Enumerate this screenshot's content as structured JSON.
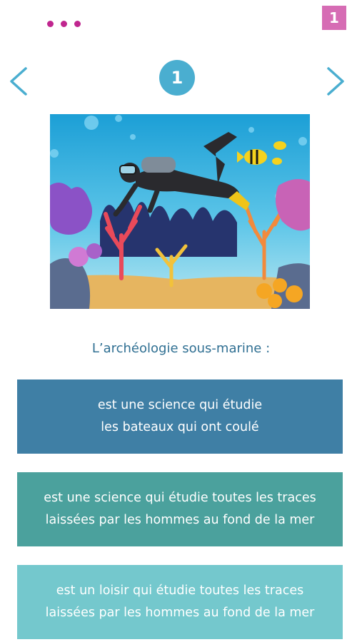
{
  "header": {
    "menu_icon": "more-dots-icon",
    "page_number": "1",
    "accent_color": "#c0268f",
    "badge_color": "#d66cb4"
  },
  "navigation": {
    "prev_icon": "chevron-left-icon",
    "next_icon": "chevron-right-icon",
    "question_number": "1"
  },
  "illustration": {
    "subject": "scuba-diver-coral-reef-illustration"
  },
  "question": {
    "prompt": "L’archéologie sous-marine :"
  },
  "answers": [
    {
      "line1": "est une science qui étudie",
      "line2": "les bateaux qui ont coulé",
      "color": "#3f7fa5"
    },
    {
      "line1": "est une science qui étudie toutes les traces",
      "line2": "laissées par les hommes au fond de la mer",
      "color": "#4ba19d"
    },
    {
      "line1": "est un loisir qui étudie toutes les traces",
      "line2": "laissées par les hommes au fond de la mer",
      "color": "#74c8cd"
    }
  ]
}
